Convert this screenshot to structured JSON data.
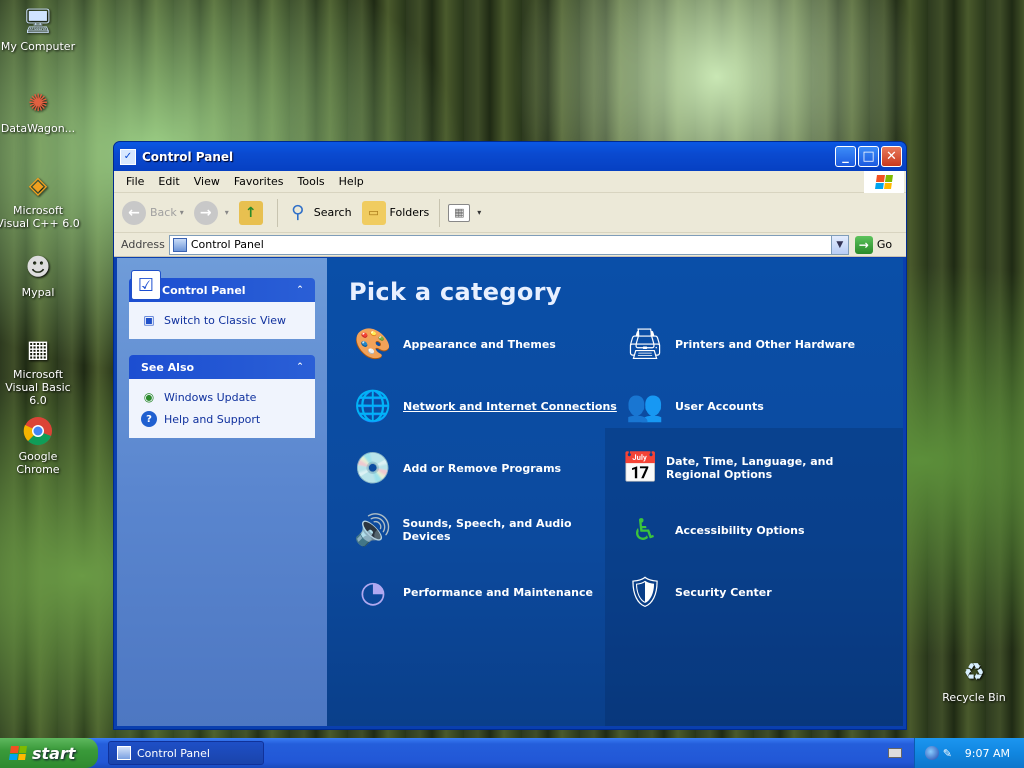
{
  "desktop": {
    "icons": [
      {
        "label": "My Computer",
        "icon": "computer-icon"
      },
      {
        "label": "DataWagon...",
        "icon": "shortcut-icon"
      },
      {
        "label": "Microsoft Visual C++ 6.0",
        "icon": "visual-cpp-icon"
      },
      {
        "label": "Mypal",
        "icon": "mypal-icon"
      },
      {
        "label": "Microsoft Visual Basic 6.0",
        "icon": "visual-basic-icon"
      },
      {
        "label": "Google Chrome",
        "icon": "chrome-icon"
      }
    ],
    "recycle_bin": "Recycle Bin"
  },
  "window": {
    "title": "Control Panel",
    "menu": [
      "File",
      "Edit",
      "View",
      "Favorites",
      "Tools",
      "Help"
    ],
    "toolbar": {
      "back": "Back",
      "search": "Search",
      "folders": "Folders"
    },
    "address": {
      "label": "Address",
      "value": "Control Panel",
      "go": "Go"
    },
    "sidebar": {
      "panel1": {
        "title": "Control Panel",
        "links": [
          "Switch to Classic View"
        ]
      },
      "panel2": {
        "title": "See Also",
        "links": [
          "Windows Update",
          "Help and Support"
        ]
      }
    },
    "main": {
      "heading": "Pick a category",
      "categories": [
        {
          "label": "Appearance and Themes",
          "icon": "appearance-icon"
        },
        {
          "label": "Printers and Other Hardware",
          "icon": "printer-icon"
        },
        {
          "label": "Network and Internet Connections",
          "icon": "network-icon"
        },
        {
          "label": "User Accounts",
          "icon": "user-accounts-icon"
        },
        {
          "label": "Add or Remove Programs",
          "icon": "add-remove-programs-icon"
        },
        {
          "label": "Date, Time, Language, and Regional Options",
          "icon": "date-time-icon"
        },
        {
          "label": "Sounds, Speech, and Audio Devices",
          "icon": "sounds-icon"
        },
        {
          "label": "Accessibility Options",
          "icon": "accessibility-icon"
        },
        {
          "label": "Performance and Maintenance",
          "icon": "performance-icon"
        },
        {
          "label": "Security Center",
          "icon": "security-shield-icon"
        }
      ]
    }
  },
  "taskbar": {
    "start": "start",
    "task": "Control Panel",
    "clock": "9:07 AM"
  }
}
